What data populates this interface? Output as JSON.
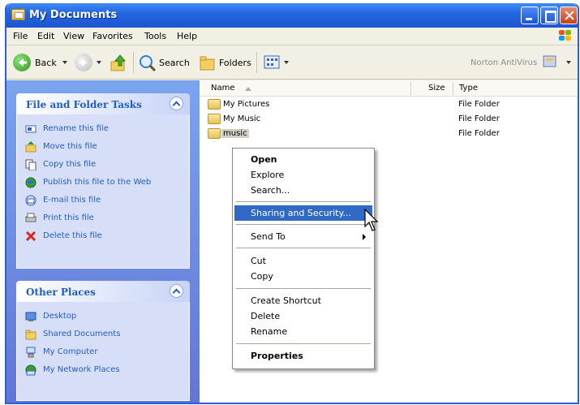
{
  "window": {
    "title": "My Documents"
  },
  "menubar": {
    "items": [
      "File",
      "Edit",
      "View",
      "Favorites",
      "Tools",
      "Help"
    ]
  },
  "toolbar": {
    "back_label": "Back",
    "search_label": "Search",
    "folders_label": "Folders",
    "norton_label": "Norton AntiVirus"
  },
  "tasks_panel": {
    "title": "File and Folder Tasks",
    "items": [
      {
        "label": "Rename this file",
        "icon": "rename-icon"
      },
      {
        "label": "Move this file",
        "icon": "move-icon"
      },
      {
        "label": "Copy this file",
        "icon": "copy-icon"
      },
      {
        "label": "Publish this file to the Web",
        "icon": "globe-icon"
      },
      {
        "label": "E-mail this file",
        "icon": "email-icon"
      },
      {
        "label": "Print this file",
        "icon": "printer-icon"
      },
      {
        "label": "Delete this file",
        "icon": "delete-icon"
      }
    ]
  },
  "places_panel": {
    "title": "Other Places",
    "items": [
      {
        "label": "Desktop",
        "icon": "desktop-icon"
      },
      {
        "label": "Shared Documents",
        "icon": "folder-icon"
      },
      {
        "label": "My Computer",
        "icon": "computer-icon"
      },
      {
        "label": "My Network Places",
        "icon": "network-icon"
      }
    ]
  },
  "columns": {
    "name": "Name",
    "size": "Size",
    "type": "Type"
  },
  "files": [
    {
      "name": "My Pictures",
      "type": "File Folder"
    },
    {
      "name": "My Music",
      "type": "File Folder"
    },
    {
      "name": "music",
      "type": "File Folder",
      "selected": true
    }
  ],
  "context_menu": {
    "open": "Open",
    "explore": "Explore",
    "search": "Search...",
    "sharing": "Sharing and Security...",
    "send_to": "Send To",
    "cut": "Cut",
    "copy": "Copy",
    "create_shortcut": "Create Shortcut",
    "delete": "Delete",
    "rename": "Rename",
    "properties": "Properties"
  },
  "colors": {
    "highlight": "#316ac5",
    "title_bar": "#2366e0",
    "task_text": "#215dc6"
  }
}
